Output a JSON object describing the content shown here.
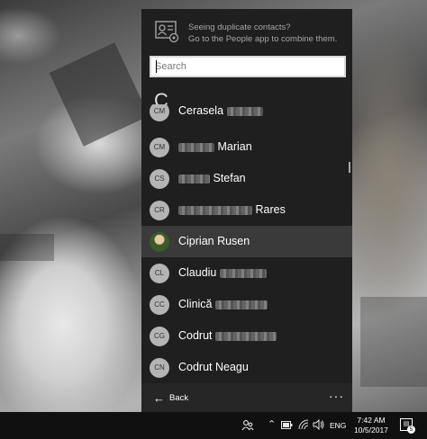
{
  "flyout": {
    "banner": {
      "line1": "Seeing duplicate contacts?",
      "line2": "Go to the People app to combine them.",
      "icon": "people-card-icon"
    },
    "search": {
      "placeholder": "Search",
      "value": ""
    },
    "section_letter": "C",
    "contacts": [
      {
        "initials": "CM",
        "first": "Cerasela",
        "last": "",
        "selected": false,
        "avatar": "initials"
      },
      {
        "initials": "CM",
        "first": "",
        "last": "Marian",
        "selected": false,
        "avatar": "initials"
      },
      {
        "initials": "CS",
        "first": "",
        "last": "Stefan",
        "selected": false,
        "avatar": "initials"
      },
      {
        "initials": "CR",
        "first": "",
        "last": "Rares",
        "selected": false,
        "avatar": "initials"
      },
      {
        "initials": "",
        "first": "Ciprian Rusen",
        "last": "",
        "selected": true,
        "avatar": "photo"
      },
      {
        "initials": "CL",
        "first": "Claudiu",
        "last": "",
        "selected": false,
        "avatar": "initials"
      },
      {
        "initials": "CC",
        "first": "Clinică",
        "last": "",
        "selected": false,
        "avatar": "initials"
      },
      {
        "initials": "CG",
        "first": "Codrut",
        "last": "",
        "selected": false,
        "avatar": "initials"
      },
      {
        "initials": "CN",
        "first": "Codrut Neagu",
        "last": "",
        "selected": false,
        "avatar": "initials"
      }
    ],
    "footer": {
      "back_label": "Back",
      "back_icon": "arrow-left-icon",
      "more_label": "···"
    }
  },
  "taskbar": {
    "language": "ENG",
    "time": "7:42 AM",
    "date": "10/5/2017",
    "notification_count": "5",
    "icons": [
      "people-icon",
      "chevron-up-icon",
      "battery-icon",
      "wifi-icon",
      "volume-icon",
      "action-center-icon"
    ]
  }
}
